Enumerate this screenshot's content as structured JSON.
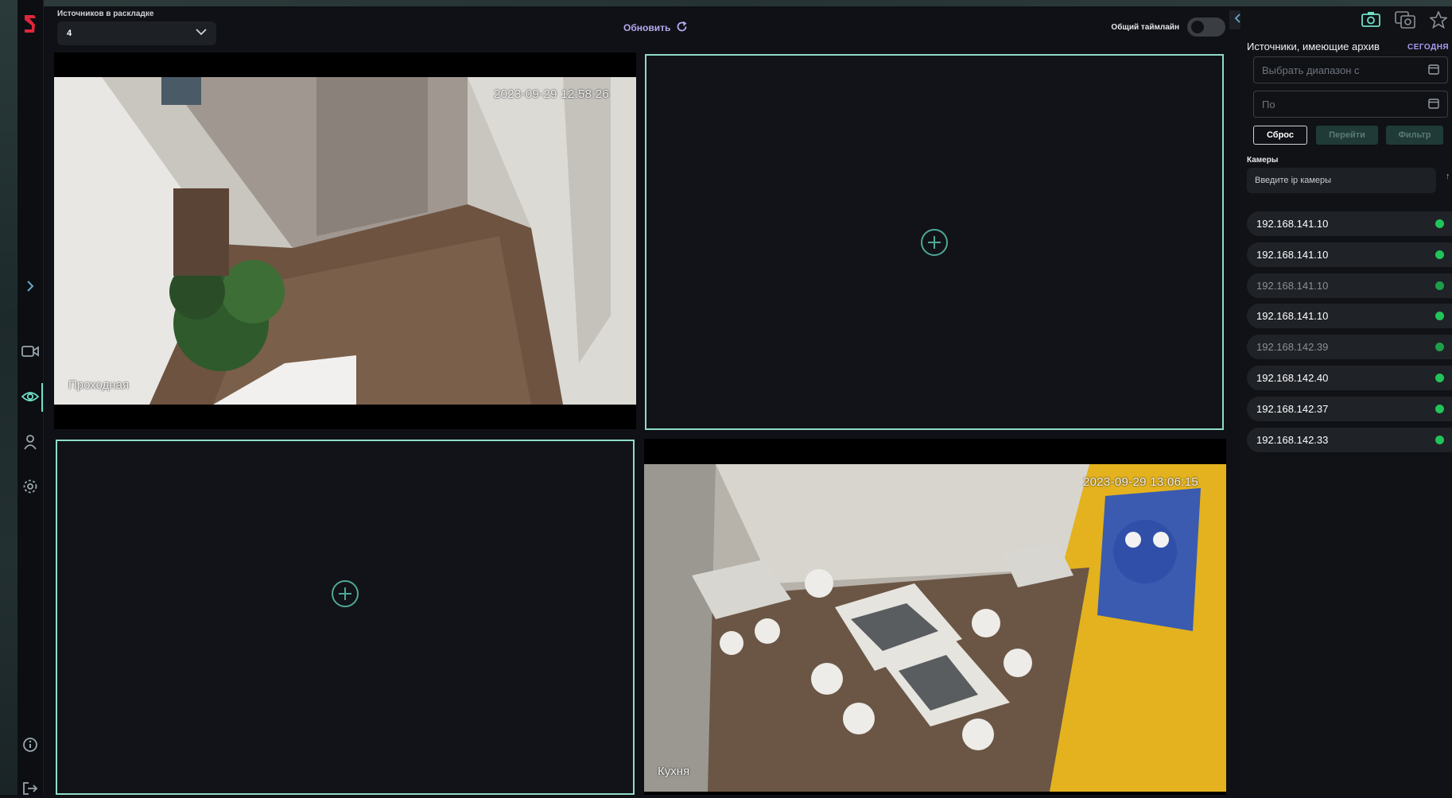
{
  "layout_label": "Источников в раскладке",
  "layout_value": "4",
  "refresh_label": "Обновить",
  "timeline_label": "Общий таймлайн",
  "colors": {
    "accent": "#8fdcc8",
    "status_online": "#21c45a",
    "link": "#b7a9f0",
    "brand": "#e0263a"
  },
  "tiles": [
    {
      "type": "camera",
      "timestamp": "2023-09-29 12:58:26",
      "name": "Проходная"
    },
    {
      "type": "empty"
    },
    {
      "type": "empty"
    },
    {
      "type": "camera",
      "timestamp": "2023-09-29 13:06:15",
      "name": "Кухня"
    }
  ],
  "right_panel": {
    "title": "Источники, имеющие архив",
    "today": "СЕГОДНЯ",
    "date_from_placeholder": "Выбрать диапазон с",
    "date_to_placeholder": "По",
    "reset_label": "Сброс",
    "go_label": "Перейти",
    "filter_label": "Фильтр",
    "cameras_label": "Камеры",
    "ip_placeholder": "Введите ip камеры",
    "cameras": [
      {
        "ip": "192.168.141.10",
        "dim": false
      },
      {
        "ip": "192.168.141.10",
        "dim": false
      },
      {
        "ip": "192.168.141.10",
        "dim": true
      },
      {
        "ip": "192.168.141.10",
        "dim": false
      },
      {
        "ip": "192.168.142.39",
        "dim": true
      },
      {
        "ip": "192.168.142.40",
        "dim": false
      },
      {
        "ip": "192.168.142.37",
        "dim": false
      },
      {
        "ip": "192.168.142.33",
        "dim": false
      }
    ]
  }
}
